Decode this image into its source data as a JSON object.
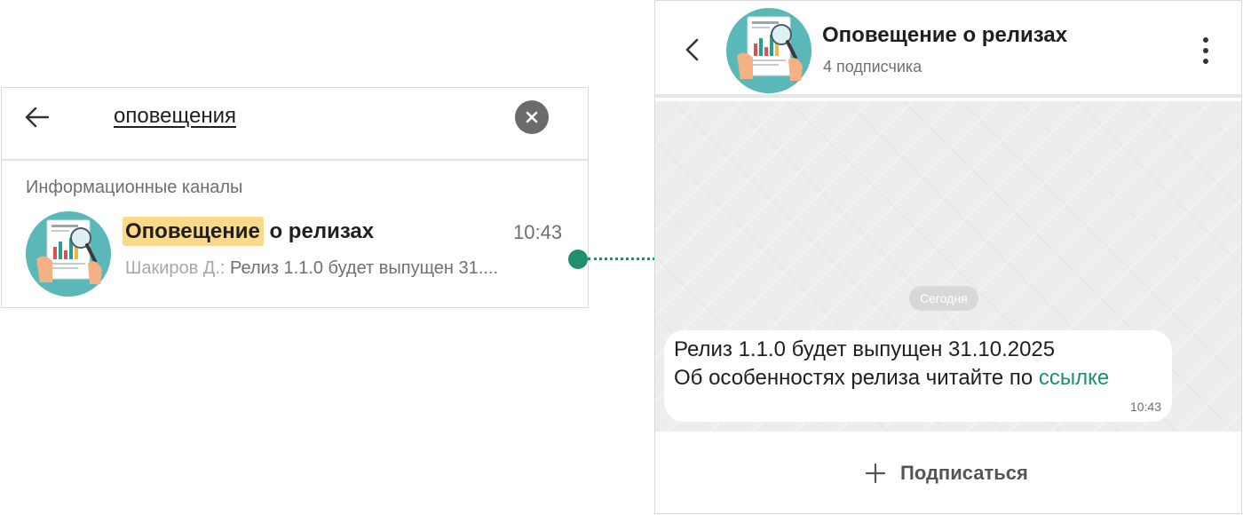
{
  "search": {
    "query": "оповещения",
    "section_title": "Информационные каналы",
    "result": {
      "title_highlight": "Оповещение",
      "title_rest": " о релизах",
      "time": "10:43",
      "snippet_author": "Шакиров Д.:",
      "snippet_text": " Релиз 1.1.0 будет выпущен 31...."
    }
  },
  "channel": {
    "title": "Оповещение о релизах",
    "subtitle": "4 подписчика",
    "date_badge": "Сегодня",
    "message": {
      "line1": "Релиз 1.1.0 будет выпущен 31.10.2025",
      "line2_prefix": "Об особенностях релиза читайте по ",
      "link_text": "ссылке",
      "time": "10:43"
    },
    "subscribe_label": "Подписаться"
  },
  "icons": {
    "back": "arrow-left-icon",
    "clear": "close-circle-icon",
    "chevron_back": "chevron-left-icon",
    "menu": "more-vertical-icon",
    "plus": "plus-icon",
    "avatar": "report-analysis-avatar"
  },
  "colors": {
    "accent": "#1f8f6f",
    "highlight": "#fbd98a",
    "avatar_bg": "#5ab8b8"
  }
}
